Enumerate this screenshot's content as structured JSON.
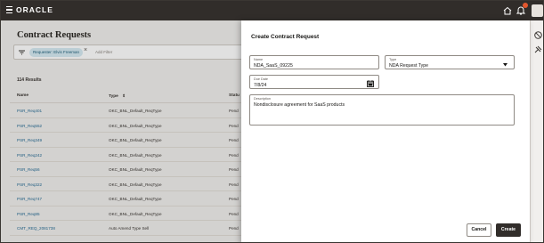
{
  "header": {
    "logo": "ORACLE",
    "icons": [
      "hamburger-icon",
      "home-icon",
      "bell-icon",
      "avatar"
    ]
  },
  "page": {
    "title": "Contract Requests",
    "filter": {
      "chip_label": "Requester: Elvis Freeman",
      "add_filter_placeholder": "Add Filter"
    },
    "results_label": "114  Results",
    "table": {
      "headers": {
        "name": "Name",
        "type": "Type",
        "status": "Statu"
      },
      "rows": [
        {
          "name": "PSR_Req401",
          "type": "OKC_BNL_Default_ReqType",
          "status": "Pend"
        },
        {
          "name": "PSR_Req552",
          "type": "OKC_BNL_Default_ReqType",
          "status": "Pend"
        },
        {
          "name": "PSR_Req349",
          "type": "OKC_BNL_Default_ReqType",
          "status": "Pend"
        },
        {
          "name": "PSR_Req242",
          "type": "OKC_BNL_Default_ReqType",
          "status": "Pend"
        },
        {
          "name": "PSR_Req56",
          "type": "OKC_BNL_Default_ReqType",
          "status": "Pend"
        },
        {
          "name": "PSR_Req322",
          "type": "OKC_BNL_Default_ReqType",
          "status": "Pend"
        },
        {
          "name": "PSR_Req747",
          "type": "OKC_BNL_Default_ReqType",
          "status": "Pend"
        },
        {
          "name": "PSR_Req85",
          "type": "OKC_BNL_Default_ReqType",
          "status": "Pend"
        },
        {
          "name": "CMT_REQ_2081738",
          "type": "Auto Amend Type Sell",
          "status": "Pend"
        }
      ]
    }
  },
  "drawer": {
    "title": "Create Contract Request",
    "name_field": {
      "label": "Name",
      "value": "NDA_SaaS_09225"
    },
    "type_field": {
      "label": "Type",
      "value": "NDA Request Type"
    },
    "due_date_field": {
      "label": "Due Date",
      "value": "7/8/24"
    },
    "description_field": {
      "label": "Description",
      "value": "Nondisclosure agreement for SaaS products"
    },
    "cancel_label": "Cancel",
    "create_label": "Create"
  },
  "colors": {
    "header_bg": "#312d2a",
    "link": "#2a6f97",
    "primary_button": "#312d2a"
  }
}
